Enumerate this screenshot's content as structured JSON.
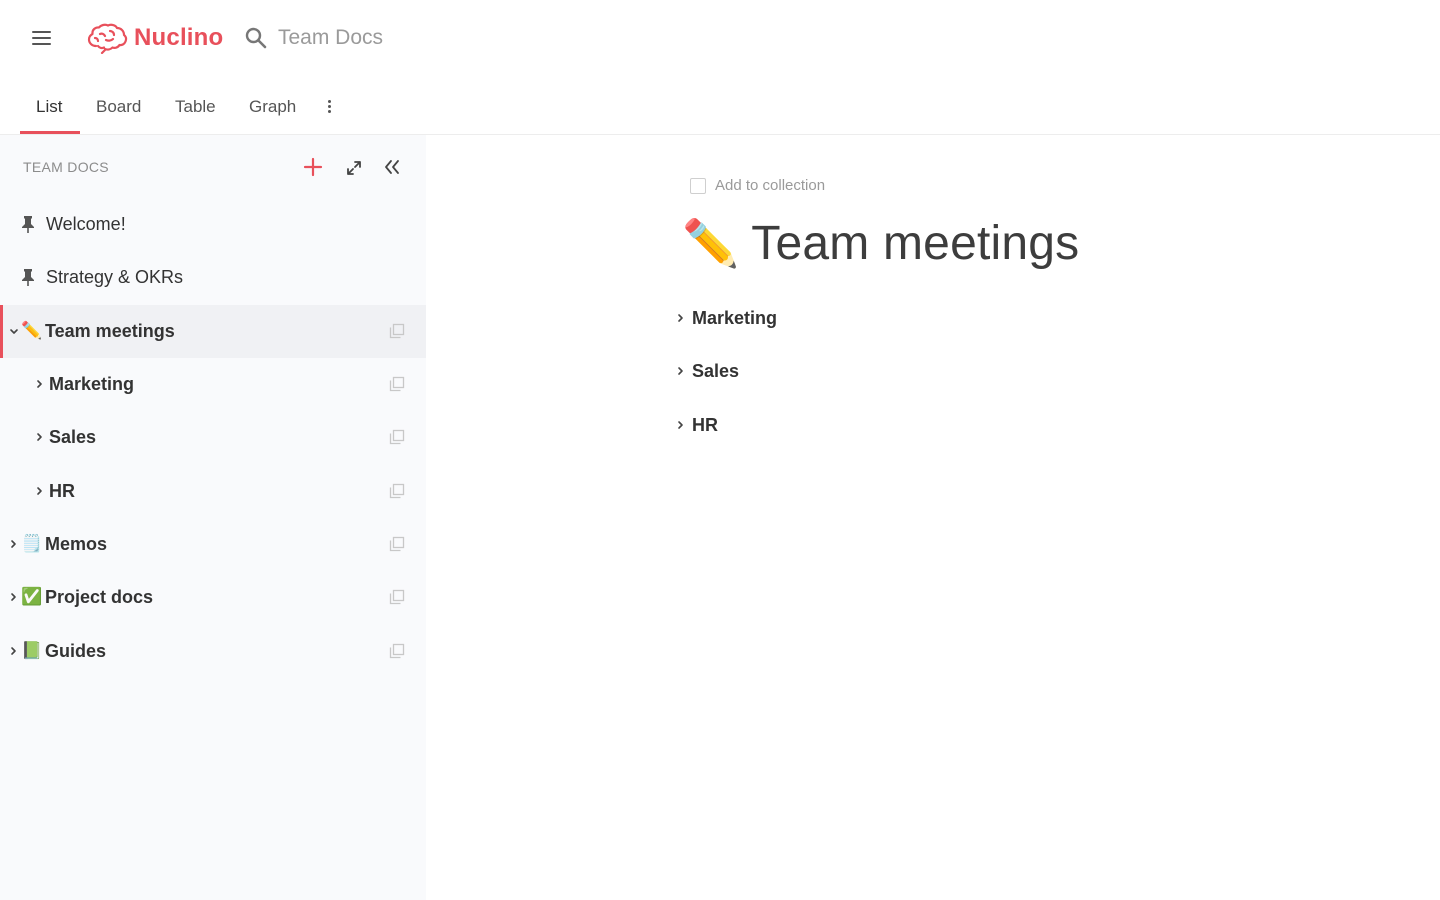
{
  "app": {
    "name": "Nuclino",
    "brand_color": "#e8505b"
  },
  "search": {
    "text": "Team Docs",
    "icon": "search-icon"
  },
  "tabs": [
    {
      "label": "List",
      "active": true
    },
    {
      "label": "Board",
      "active": false
    },
    {
      "label": "Table",
      "active": false
    },
    {
      "label": "Graph",
      "active": false
    }
  ],
  "sidebar": {
    "header": "TEAM DOCS",
    "items": [
      {
        "label": "Welcome!",
        "pinned": true
      },
      {
        "label": "Strategy & OKRs",
        "pinned": true
      },
      {
        "label": "Team meetings",
        "emoji": "✏️",
        "expanded": true,
        "selected": true
      },
      {
        "label": "Marketing",
        "child": true
      },
      {
        "label": "Sales",
        "child": true
      },
      {
        "label": "HR",
        "child": true
      },
      {
        "label": "Memos",
        "emoji": "🗒️"
      },
      {
        "label": "Project docs",
        "emoji": "✅"
      },
      {
        "label": "Guides",
        "emoji": "📗"
      }
    ]
  },
  "main": {
    "add_to_collection": "Add to collection",
    "title_emoji": "✏️",
    "title": "Team meetings",
    "sub_items": [
      {
        "label": "Marketing"
      },
      {
        "label": "Sales"
      },
      {
        "label": "HR"
      }
    ]
  }
}
